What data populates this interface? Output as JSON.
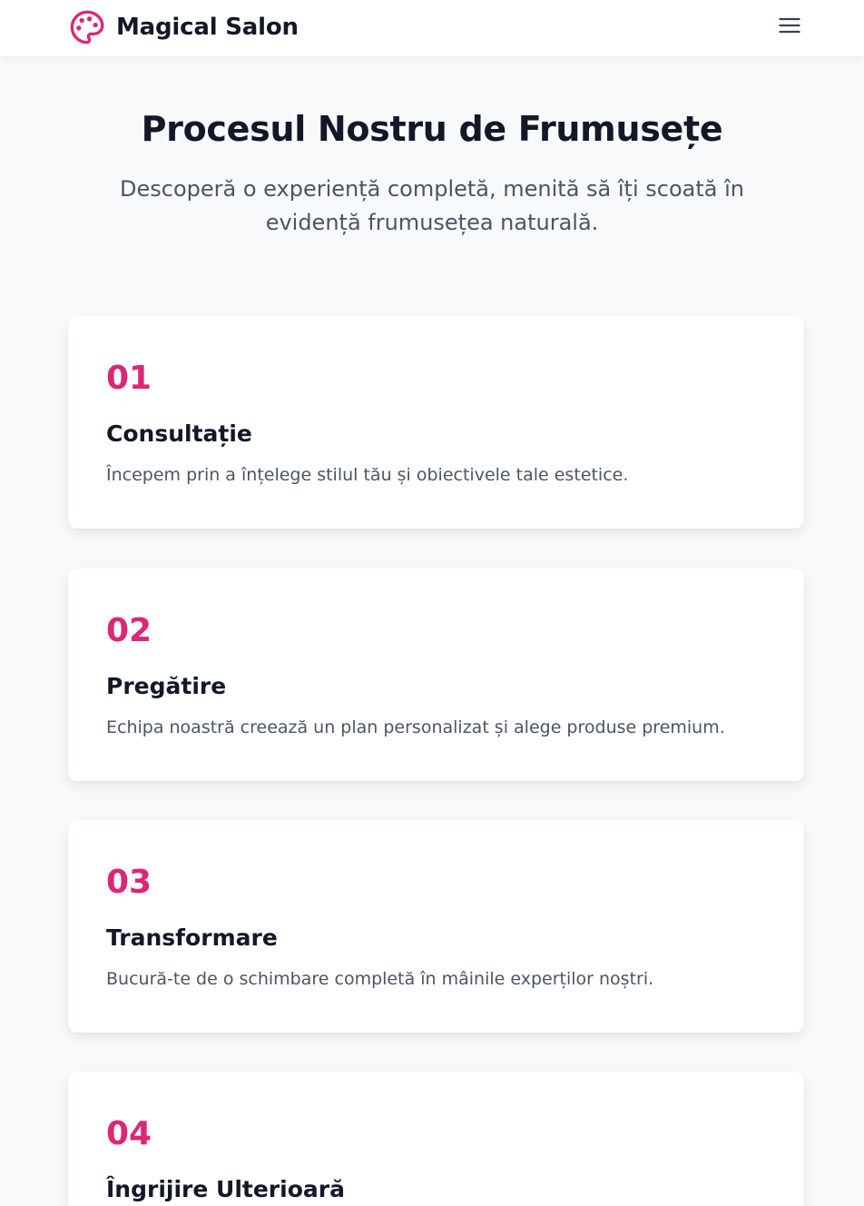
{
  "header": {
    "brand_name": "Magical Salon",
    "brand_icon": "palette-icon",
    "menu_icon": "hamburger-menu-icon"
  },
  "hero": {
    "title": "Procesul Nostru de Frumusețe",
    "subtitle": "Descoperă o experiență completă, menită să îți scoată în evidență frumusețea naturală."
  },
  "steps": [
    {
      "number": "01",
      "title": "Consultație",
      "description": "Începem prin a înțelege stilul tău și obiectivele tale estetice."
    },
    {
      "number": "02",
      "title": "Pregătire",
      "description": "Echipa noastră creează un plan personalizat și alege produse premium."
    },
    {
      "number": "03",
      "title": "Transformare",
      "description": "Bucură-te de o schimbare completă în mâinile experților noștri."
    },
    {
      "number": "04",
      "title": "Îngrijire Ulterioară",
      "description": ""
    }
  ],
  "colors": {
    "accent": "#db2777",
    "heading": "#111827",
    "body_text": "#4b5563",
    "background": "#f8f9fb"
  }
}
